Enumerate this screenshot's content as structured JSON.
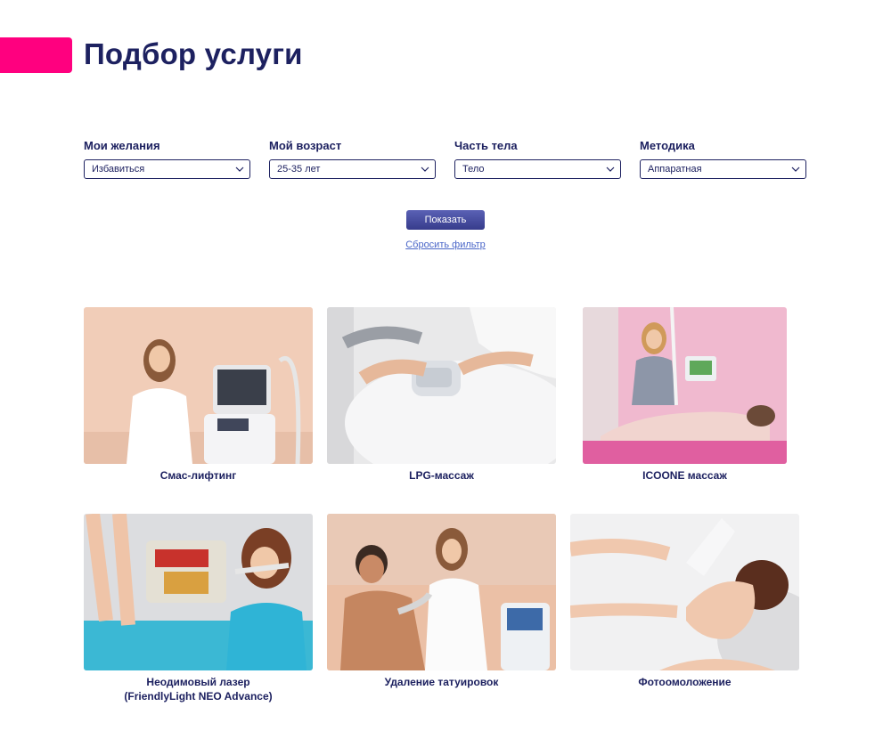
{
  "page": {
    "title": "Подбор услуги"
  },
  "filters": [
    {
      "label": "Мои желания",
      "value": "Избавиться"
    },
    {
      "label": "Мой возраст",
      "value": "25-35 лет"
    },
    {
      "label": "Часть тела",
      "value": "Тело"
    },
    {
      "label": "Методика",
      "value": "Аппаратная"
    }
  ],
  "actions": {
    "show_label": "Показать",
    "reset_label": "Сбросить фильтр"
  },
  "services": [
    {
      "title": "Смас-лифтинг"
    },
    {
      "title": "LPG-массаж"
    },
    {
      "title": "ICOONE массаж"
    },
    {
      "title": "Неодимовый лазер\n(FriendlyLight NEO Advance)"
    },
    {
      "title": "Удаление татуировок"
    },
    {
      "title": "Фотоомоложение"
    }
  ],
  "colors": {
    "accent": "#ff007f",
    "primary": "#1d2160",
    "button": "#4a50a4",
    "link": "#4a66c8"
  }
}
